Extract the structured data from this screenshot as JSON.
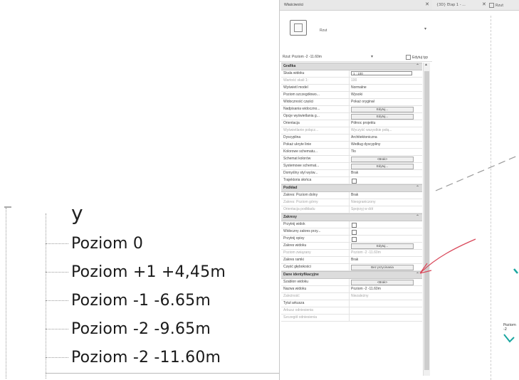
{
  "tree": {
    "fragment": "y",
    "items": [
      {
        "label": "Poziom 0"
      },
      {
        "label": "Poziom +1 +4,45m"
      },
      {
        "label": "Poziom -1 -6.65m"
      },
      {
        "label": "Poziom -2 -9.65m"
      },
      {
        "label": "Poziom -2 -11.60m"
      }
    ]
  },
  "properties": {
    "title": "Właściwości",
    "close": "✕",
    "type_name": "Rzut",
    "type_chevron": "▾",
    "view_selector": "Rzut: Poziom -2 -11.60m",
    "view_selector_arrow": "▾",
    "edit_type": "Edytuj typ",
    "scroll_up": "▲",
    "sections": [
      {
        "title": "Grafika",
        "collapse": "⌃",
        "rows": [
          {
            "name": "Skala widoku",
            "value": "1 : 100",
            "kind": "input"
          },
          {
            "name": "Wartość skali 1:",
            "value": "100",
            "kind": "text",
            "dim": true
          },
          {
            "name": "Wyświetl model",
            "value": "Normalne",
            "kind": "text"
          },
          {
            "name": "Poziom szczegółowo...",
            "value": "Wysoki",
            "kind": "text"
          },
          {
            "name": "Widoczność części",
            "value": "Pokaż oryginał",
            "kind": "text"
          },
          {
            "name": "Nadpisania widoczno...",
            "value": "Edytuj...",
            "kind": "button"
          },
          {
            "name": "Opcje wyświetlania g...",
            "value": "Edytuj...",
            "kind": "button"
          },
          {
            "name": "Orientacja",
            "value": "Północ projektu",
            "kind": "text"
          },
          {
            "name": "Wyświetlanie połącz...",
            "value": "Wyczyść wszystkie połą...",
            "kind": "text",
            "dim": true
          },
          {
            "name": "Dyscyplina",
            "value": "Architektoniczna",
            "kind": "text"
          },
          {
            "name": "Pokaż ukryte linie",
            "value": "Według dyscypliny",
            "kind": "text"
          },
          {
            "name": "Kolorowe schematu...",
            "value": "Tło",
            "kind": "text"
          },
          {
            "name": "Schemat kolorów",
            "value": "<Brak>",
            "kind": "button"
          },
          {
            "name": "Systemowe schemat...",
            "value": "Edytuj...",
            "kind": "button"
          },
          {
            "name": "Domyślny styl wyśw...",
            "value": "Brak",
            "kind": "text"
          },
          {
            "name": "Trajektoria słońca",
            "value": "",
            "kind": "check"
          }
        ]
      },
      {
        "title": "Podkład",
        "collapse": "⌃",
        "rows": [
          {
            "name": "Zakres: Poziom dolny",
            "value": "Brak",
            "kind": "text"
          },
          {
            "name": "Zakres: Poziom górny",
            "value": "Nieograniczony",
            "kind": "text",
            "dim": true
          },
          {
            "name": "Orientacja podkładu",
            "value": "Spojrzyj w dół",
            "kind": "text",
            "dim": true
          }
        ]
      },
      {
        "title": "Zakresy",
        "collapse": "⌃",
        "rows": [
          {
            "name": "Przytnij widok",
            "value": "",
            "kind": "check"
          },
          {
            "name": "Widoczny zakres przy...",
            "value": "",
            "kind": "check"
          },
          {
            "name": "Przytnij opisy",
            "value": "",
            "kind": "check"
          },
          {
            "name": "Zakres widoku",
            "value": "Edytuj...",
            "kind": "button"
          },
          {
            "name": "Poziom związany",
            "value": "Poziom -2 -11.60m",
            "kind": "text",
            "dim": true
          },
          {
            "name": "Zakres ramki",
            "value": "Brak",
            "kind": "text"
          },
          {
            "name": "Część głębokości",
            "value": "Bez przycinania",
            "kind": "button"
          }
        ]
      },
      {
        "title": "Dane identyfikacyjne",
        "collapse": "⌃",
        "rows": [
          {
            "name": "Szablon widoku",
            "value": "<Brak>",
            "kind": "button"
          },
          {
            "name": "Nazwa widoku",
            "value": "Poziom -2 -11.60m",
            "kind": "text"
          },
          {
            "name": "Zależność",
            "value": "Niezależny",
            "kind": "text",
            "dim": true
          },
          {
            "name": "Tytuł arkusza",
            "value": "",
            "kind": "text"
          },
          {
            "name": "Arkusz odniesienia",
            "value": "",
            "kind": "text",
            "dim": true
          },
          {
            "name": "Szczegół odniesienia",
            "value": "",
            "kind": "text",
            "dim": true
          }
        ]
      }
    ]
  },
  "viewport": {
    "tab_label": "{3D} Etap 1 - ...",
    "tab_close": "✕",
    "tab2_label": "Rzut",
    "level_label": "Poziom -2",
    "sketch_color": "#d9485a",
    "marker_color": "#1aa6a0",
    "line_color": "#9a9a9a"
  }
}
